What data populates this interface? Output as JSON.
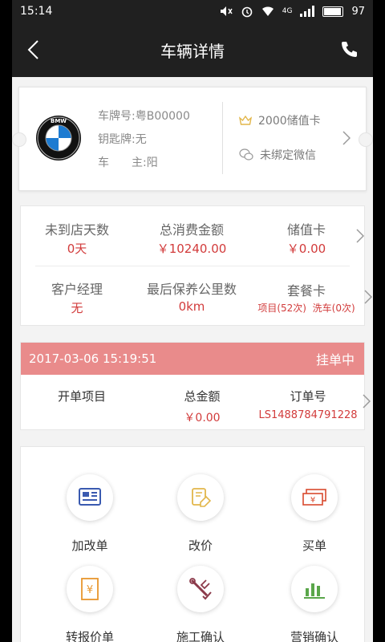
{
  "status": {
    "time": "15:14",
    "network": "4G",
    "battery": "97"
  },
  "nav": {
    "title": "车辆详情"
  },
  "car": {
    "plate_label": "车牌号:",
    "plate": "粤B00000",
    "key_label": "钥匙牌:",
    "key": "无",
    "owner_label": "车　　主:",
    "owner": "阳",
    "brand_logo_text": "BMW"
  },
  "membership": {
    "stored_card": "2000储值卡",
    "wechat": "未绑定微信"
  },
  "stats": {
    "days_label": "未到店天数",
    "days": "0天",
    "total_label": "总消费金额",
    "total": "￥10240.00",
    "stored_label": "储值卡",
    "stored": "￥0.00",
    "manager_label": "客户经理",
    "manager": "无",
    "mileage_label": "最后保养公里数",
    "mileage": "0km",
    "package_label": "套餐卡",
    "package_items": "项目(52次)",
    "package_wash": "洗车(0次)"
  },
  "order": {
    "time": "2017-03-06  15:19:51",
    "status": "挂单中",
    "project_label": "开单项目",
    "amount_label": "总金额",
    "amount": "￥0.00",
    "no_label": "订单号",
    "no": "LS1488784791228"
  },
  "menu": [
    {
      "label": "加改单"
    },
    {
      "label": "改价"
    },
    {
      "label": "买单"
    },
    {
      "label": "转报价单"
    },
    {
      "label": "施工确认"
    },
    {
      "label": "营销确认"
    }
  ],
  "colors": {
    "accent_red": "#d23b3b",
    "order_header": "#e98b8b",
    "dark_bar": "#202020"
  }
}
